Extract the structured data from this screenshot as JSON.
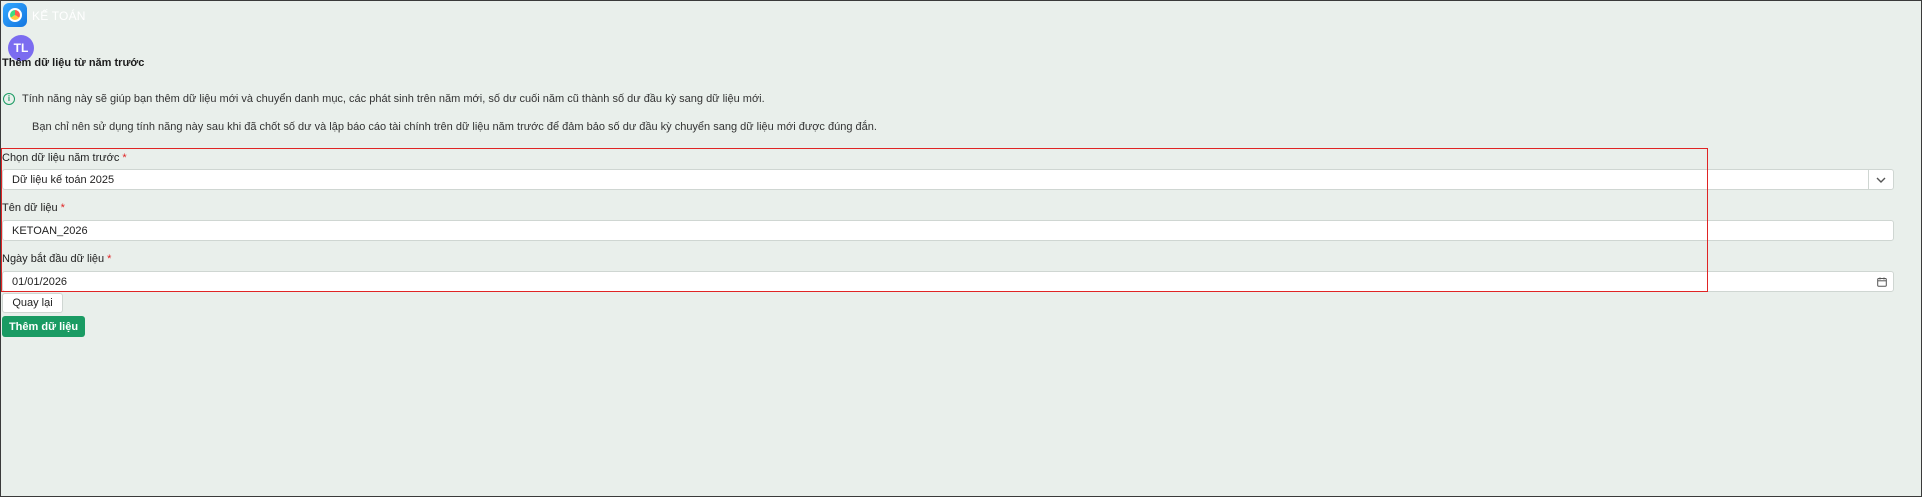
{
  "app": {
    "name": "KẾ TOÁN"
  },
  "user": {
    "initials": "TL"
  },
  "page": {
    "title": "Thêm dữ liệu từ năm trước"
  },
  "info": {
    "line1": "Tính năng này sẽ giúp bạn thêm dữ liệu mới và chuyển danh mục, các phát sinh trên năm mới, số dư cuối năm cũ thành số dư đầu kỳ sang dữ liệu mới.",
    "line2": "Bạn chỉ nên sử dụng tính năng này sau khi đã chốt số dư và lập báo cáo tài chính trên dữ liệu năm trước để đảm bảo số dư đầu kỳ chuyển sang dữ liệu mới được đúng đắn."
  },
  "form": {
    "required_mark": "*",
    "prev_data": {
      "label": "Chọn dữ liệu năm trước",
      "value": "Dữ liệu kế toán 2025"
    },
    "data_name": {
      "label": "Tên dữ liệu",
      "value": "KETOAN_2026"
    },
    "start_date": {
      "label": "Ngày bắt đầu dữ liệu",
      "value": "01/01/2026"
    }
  },
  "buttons": {
    "back": "Quay lại",
    "add": "Thêm dữ liệu"
  },
  "colors": {
    "accent": "#1a9b63",
    "highlight": "#e02424",
    "avatar": "#7b6cf0",
    "background": "#e9efeb"
  },
  "icons": {
    "info": "info-circle-icon",
    "select": "chevron-down-icon",
    "date": "calendar-icon",
    "logo": "app-logo-icon"
  }
}
